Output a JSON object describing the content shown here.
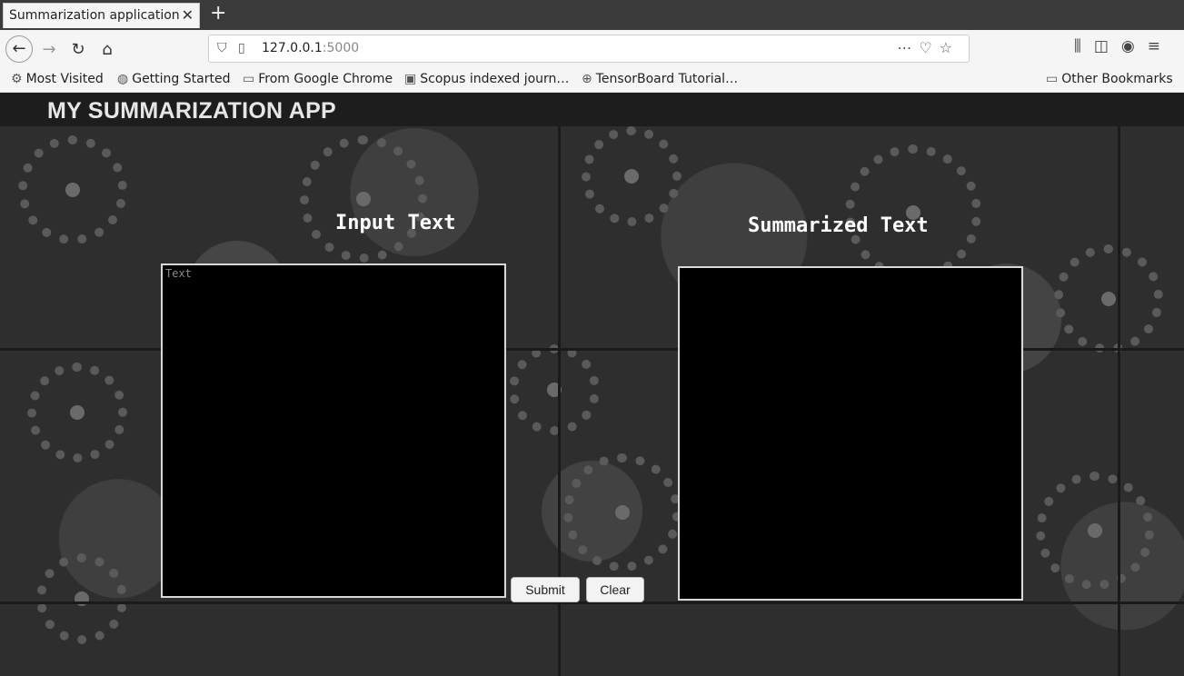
{
  "browser": {
    "tab_title": "Summarization application",
    "tab_close": "✕",
    "new_tab": "+",
    "url_host": "127.0.0.1",
    "url_port": ":5000",
    "bookmarks": [
      {
        "label": "Most Visited",
        "icon": "gear-icon"
      },
      {
        "label": "Getting Started",
        "icon": "firefox-icon"
      },
      {
        "label": "From Google Chrome",
        "icon": "folder-icon"
      },
      {
        "label": "Scopus indexed journ…",
        "icon": "page-icon"
      },
      {
        "label": "TensorBoard Tutorial…",
        "icon": "globe-icon"
      },
      {
        "label": "Other Bookmarks",
        "icon": "folder-icon"
      }
    ]
  },
  "app": {
    "title": "MY SUMMARIZATION APP",
    "input_heading": "Input Text",
    "output_heading": "Summarized Text",
    "input_placeholder": "Text",
    "output_value": "",
    "submit_label": "Submit",
    "clear_label": "Clear"
  }
}
